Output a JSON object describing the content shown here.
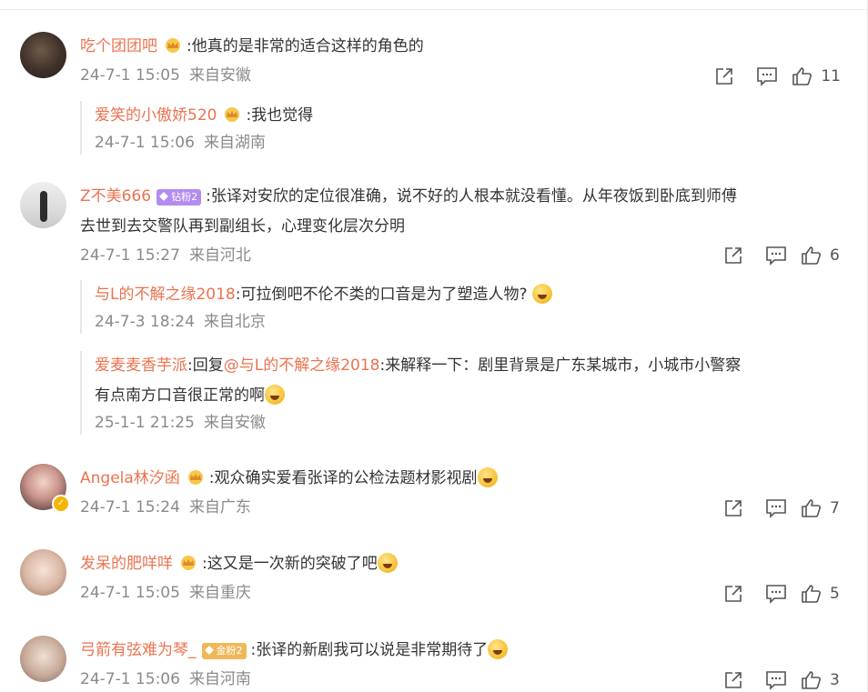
{
  "comments": [
    {
      "user": "吃个团团吧",
      "text": ":他真的是非常的适合这样的角色的",
      "date": "24-7-1 15:05",
      "location": "来自安徽",
      "likes": "11",
      "replies": [
        {
          "user": "爱笑的小傲娇520",
          "text": ":我也觉得",
          "date": "24-7-1 15:06",
          "location": "来自湖南"
        }
      ]
    },
    {
      "user": "Z不美666",
      "badge": "钻粉2",
      "text_line1": ":张译对安欣的定位很准确，说不好的人根本就没看懂。从年夜饭到卧底到师傅",
      "text_line2": "去世到去交警队再到副组长，心理变化层次分明",
      "date": "24-7-1 15:27",
      "location": "来自河北",
      "likes": "6",
      "replies": [
        {
          "user": "与L的不解之缘2018",
          "text": ":可拉倒吧不伦不类的口音是为了塑造人物?",
          "date": "24-7-3 18:24",
          "location": "来自北京"
        },
        {
          "user": "爱麦麦香芋派",
          "prefix": ":回复",
          "mention": "@与L的不解之缘2018",
          "text_line1": ":来解释一下：剧里背景是广东某城市，小城市小警察",
          "text_line2": "有点南方口音很正常的啊",
          "date": "25-1-1 21:25",
          "location": "来自安徽"
        }
      ]
    },
    {
      "user": "Angela林汐函",
      "text": ":观众确实爱看张译的公检法题材影视剧",
      "date": "24-7-1 15:24",
      "location": "来自广东",
      "likes": "7"
    },
    {
      "user": "发呆的肥咩咩",
      "text": ":这又是一次新的突破了吧",
      "date": "24-7-1 15:05",
      "location": "来自重庆",
      "likes": "5"
    },
    {
      "user": "弓箭有弦难为琴_",
      "badge": "金粉2",
      "text": ":张译的新剧我可以说是非常期待了",
      "date": "24-7-1 15:06",
      "location": "来自河南",
      "likes": "3"
    }
  ],
  "icons": {
    "share": "share-icon",
    "comment": "comment-icon",
    "like": "thumbs-up-icon",
    "crown": "crown-badge-icon"
  },
  "colors": {
    "username": "#eb7350",
    "meta": "#8a8a8a",
    "text": "#333333"
  }
}
